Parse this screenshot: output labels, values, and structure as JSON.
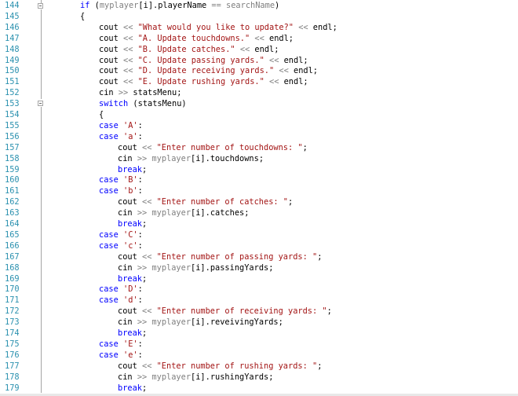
{
  "lines": [
    {
      "num": "144",
      "indent": 3,
      "tokens": [
        [
          "kw",
          "if"
        ],
        [
          "t",
          " ("
        ],
        [
          "gray",
          "myplayer"
        ],
        [
          "t",
          "[i].playerName "
        ],
        [
          "gray",
          "=="
        ],
        [
          "t",
          " "
        ],
        [
          "gray",
          "searchName"
        ],
        [
          "t",
          ")"
        ]
      ]
    },
    {
      "num": "145",
      "indent": 3,
      "tokens": [
        [
          "t",
          "{"
        ]
      ]
    },
    {
      "num": "146",
      "indent": 4,
      "tokens": [
        [
          "t",
          "cout "
        ],
        [
          "gray",
          "<<"
        ],
        [
          "t",
          " "
        ],
        [
          "str",
          "\"What would you like to update?\""
        ],
        [
          "t",
          " "
        ],
        [
          "gray",
          "<<"
        ],
        [
          "t",
          " endl;"
        ]
      ]
    },
    {
      "num": "147",
      "indent": 4,
      "tokens": [
        [
          "t",
          "cout "
        ],
        [
          "gray",
          "<<"
        ],
        [
          "t",
          " "
        ],
        [
          "str",
          "\"A. Update touchdowns.\""
        ],
        [
          "t",
          " "
        ],
        [
          "gray",
          "<<"
        ],
        [
          "t",
          " endl;"
        ]
      ]
    },
    {
      "num": "148",
      "indent": 4,
      "tokens": [
        [
          "t",
          "cout "
        ],
        [
          "gray",
          "<<"
        ],
        [
          "t",
          " "
        ],
        [
          "str",
          "\"B. Update catches.\""
        ],
        [
          "t",
          " "
        ],
        [
          "gray",
          "<<"
        ],
        [
          "t",
          " endl;"
        ]
      ]
    },
    {
      "num": "149",
      "indent": 4,
      "tokens": [
        [
          "t",
          "cout "
        ],
        [
          "gray",
          "<<"
        ],
        [
          "t",
          " "
        ],
        [
          "str",
          "\"C. Update passing yards.\""
        ],
        [
          "t",
          " "
        ],
        [
          "gray",
          "<<"
        ],
        [
          "t",
          " endl;"
        ]
      ]
    },
    {
      "num": "150",
      "indent": 4,
      "tokens": [
        [
          "t",
          "cout "
        ],
        [
          "gray",
          "<<"
        ],
        [
          "t",
          " "
        ],
        [
          "str",
          "\"D. Update receiving yards.\""
        ],
        [
          "t",
          " "
        ],
        [
          "gray",
          "<<"
        ],
        [
          "t",
          " endl;"
        ]
      ]
    },
    {
      "num": "151",
      "indent": 4,
      "tokens": [
        [
          "t",
          "cout "
        ],
        [
          "gray",
          "<<"
        ],
        [
          "t",
          " "
        ],
        [
          "str",
          "\"E. Update rushing yards.\""
        ],
        [
          "t",
          " "
        ],
        [
          "gray",
          "<<"
        ],
        [
          "t",
          " endl;"
        ]
      ]
    },
    {
      "num": "152",
      "indent": 4,
      "tokens": [
        [
          "t",
          "cin "
        ],
        [
          "gray",
          ">>"
        ],
        [
          "t",
          " statsMenu;"
        ]
      ]
    },
    {
      "num": "153",
      "indent": 4,
      "tokens": [
        [
          "kw",
          "switch"
        ],
        [
          "t",
          " (statsMenu)"
        ]
      ]
    },
    {
      "num": "154",
      "indent": 4,
      "tokens": [
        [
          "t",
          "{"
        ]
      ]
    },
    {
      "num": "155",
      "indent": 4,
      "tokens": [
        [
          "kw",
          "case"
        ],
        [
          "t",
          " "
        ],
        [
          "ch",
          "'A'"
        ],
        [
          "t",
          ":"
        ]
      ]
    },
    {
      "num": "156",
      "indent": 4,
      "tokens": [
        [
          "kw",
          "case"
        ],
        [
          "t",
          " "
        ],
        [
          "ch",
          "'a'"
        ],
        [
          "t",
          ":"
        ]
      ]
    },
    {
      "num": "157",
      "indent": 5,
      "tokens": [
        [
          "t",
          "cout "
        ],
        [
          "gray",
          "<<"
        ],
        [
          "t",
          " "
        ],
        [
          "str",
          "\"Enter number of touchdowns: \""
        ],
        [
          "t",
          ";"
        ]
      ]
    },
    {
      "num": "158",
      "indent": 5,
      "tokens": [
        [
          "t",
          "cin "
        ],
        [
          "gray",
          ">>"
        ],
        [
          "t",
          " "
        ],
        [
          "gray",
          "myplayer"
        ],
        [
          "t",
          "[i].touchdowns;"
        ]
      ]
    },
    {
      "num": "159",
      "indent": 5,
      "tokens": [
        [
          "kw",
          "break"
        ],
        [
          "t",
          ";"
        ]
      ]
    },
    {
      "num": "160",
      "indent": 4,
      "tokens": [
        [
          "kw",
          "case"
        ],
        [
          "t",
          " "
        ],
        [
          "ch",
          "'B'"
        ],
        [
          "t",
          ":"
        ]
      ]
    },
    {
      "num": "161",
      "indent": 4,
      "tokens": [
        [
          "kw",
          "case"
        ],
        [
          "t",
          " "
        ],
        [
          "ch",
          "'b'"
        ],
        [
          "t",
          ":"
        ]
      ]
    },
    {
      "num": "162",
      "indent": 5,
      "tokens": [
        [
          "t",
          "cout "
        ],
        [
          "gray",
          "<<"
        ],
        [
          "t",
          " "
        ],
        [
          "str",
          "\"Enter number of catches: \""
        ],
        [
          "t",
          ";"
        ]
      ]
    },
    {
      "num": "163",
      "indent": 5,
      "tokens": [
        [
          "t",
          "cin "
        ],
        [
          "gray",
          ">>"
        ],
        [
          "t",
          " "
        ],
        [
          "gray",
          "myplayer"
        ],
        [
          "t",
          "[i].catches;"
        ]
      ]
    },
    {
      "num": "164",
      "indent": 5,
      "tokens": [
        [
          "kw",
          "break"
        ],
        [
          "t",
          ";"
        ]
      ]
    },
    {
      "num": "165",
      "indent": 4,
      "tokens": [
        [
          "kw",
          "case"
        ],
        [
          "t",
          " "
        ],
        [
          "ch",
          "'C'"
        ],
        [
          "t",
          ":"
        ]
      ]
    },
    {
      "num": "166",
      "indent": 4,
      "tokens": [
        [
          "kw",
          "case"
        ],
        [
          "t",
          " "
        ],
        [
          "ch",
          "'c'"
        ],
        [
          "t",
          ":"
        ]
      ]
    },
    {
      "num": "167",
      "indent": 5,
      "tokens": [
        [
          "t",
          "cout "
        ],
        [
          "gray",
          "<<"
        ],
        [
          "t",
          " "
        ],
        [
          "str",
          "\"Enter number of passing yards: \""
        ],
        [
          "t",
          ";"
        ]
      ]
    },
    {
      "num": "168",
      "indent": 5,
      "tokens": [
        [
          "t",
          "cin "
        ],
        [
          "gray",
          ">>"
        ],
        [
          "t",
          " "
        ],
        [
          "gray",
          "myplayer"
        ],
        [
          "t",
          "[i].passingYards;"
        ]
      ]
    },
    {
      "num": "169",
      "indent": 5,
      "tokens": [
        [
          "kw",
          "break"
        ],
        [
          "t",
          ";"
        ]
      ]
    },
    {
      "num": "170",
      "indent": 4,
      "tokens": [
        [
          "kw",
          "case"
        ],
        [
          "t",
          " "
        ],
        [
          "ch",
          "'D'"
        ],
        [
          "t",
          ":"
        ]
      ]
    },
    {
      "num": "171",
      "indent": 4,
      "tokens": [
        [
          "kw",
          "case"
        ],
        [
          "t",
          " "
        ],
        [
          "ch",
          "'d'"
        ],
        [
          "t",
          ":"
        ]
      ]
    },
    {
      "num": "172",
      "indent": 5,
      "tokens": [
        [
          "t",
          "cout "
        ],
        [
          "gray",
          "<<"
        ],
        [
          "t",
          " "
        ],
        [
          "str",
          "\"Enter number of receiving yards: \""
        ],
        [
          "t",
          ";"
        ]
      ]
    },
    {
      "num": "173",
      "indent": 5,
      "tokens": [
        [
          "t",
          "cin "
        ],
        [
          "gray",
          ">>"
        ],
        [
          "t",
          " "
        ],
        [
          "gray",
          "myplayer"
        ],
        [
          "t",
          "[i].reveivingYards;"
        ]
      ]
    },
    {
      "num": "174",
      "indent": 5,
      "tokens": [
        [
          "kw",
          "break"
        ],
        [
          "t",
          ";"
        ]
      ]
    },
    {
      "num": "175",
      "indent": 4,
      "tokens": [
        [
          "kw",
          "case"
        ],
        [
          "t",
          " "
        ],
        [
          "ch",
          "'E'"
        ],
        [
          "t",
          ":"
        ]
      ]
    },
    {
      "num": "176",
      "indent": 4,
      "tokens": [
        [
          "kw",
          "case"
        ],
        [
          "t",
          " "
        ],
        [
          "ch",
          "'e'"
        ],
        [
          "t",
          ":"
        ]
      ]
    },
    {
      "num": "177",
      "indent": 5,
      "tokens": [
        [
          "t",
          "cout "
        ],
        [
          "gray",
          "<<"
        ],
        [
          "t",
          " "
        ],
        [
          "str",
          "\"Enter number of rushing yards: \""
        ],
        [
          "t",
          ";"
        ]
      ]
    },
    {
      "num": "178",
      "indent": 5,
      "tokens": [
        [
          "t",
          "cin "
        ],
        [
          "gray",
          ">>"
        ],
        [
          "t",
          " "
        ],
        [
          "gray",
          "myplayer"
        ],
        [
          "t",
          "[i].rushingYards;"
        ]
      ]
    },
    {
      "num": "179",
      "indent": 5,
      "tokens": [
        [
          "kw",
          "break"
        ],
        [
          "t",
          ";"
        ]
      ]
    }
  ],
  "colors": {
    "line_number": "#2b91af",
    "keyword": "#0000ff",
    "string": "#a31515",
    "operator": "#808080",
    "fold_guide": "#a5a5a5"
  }
}
